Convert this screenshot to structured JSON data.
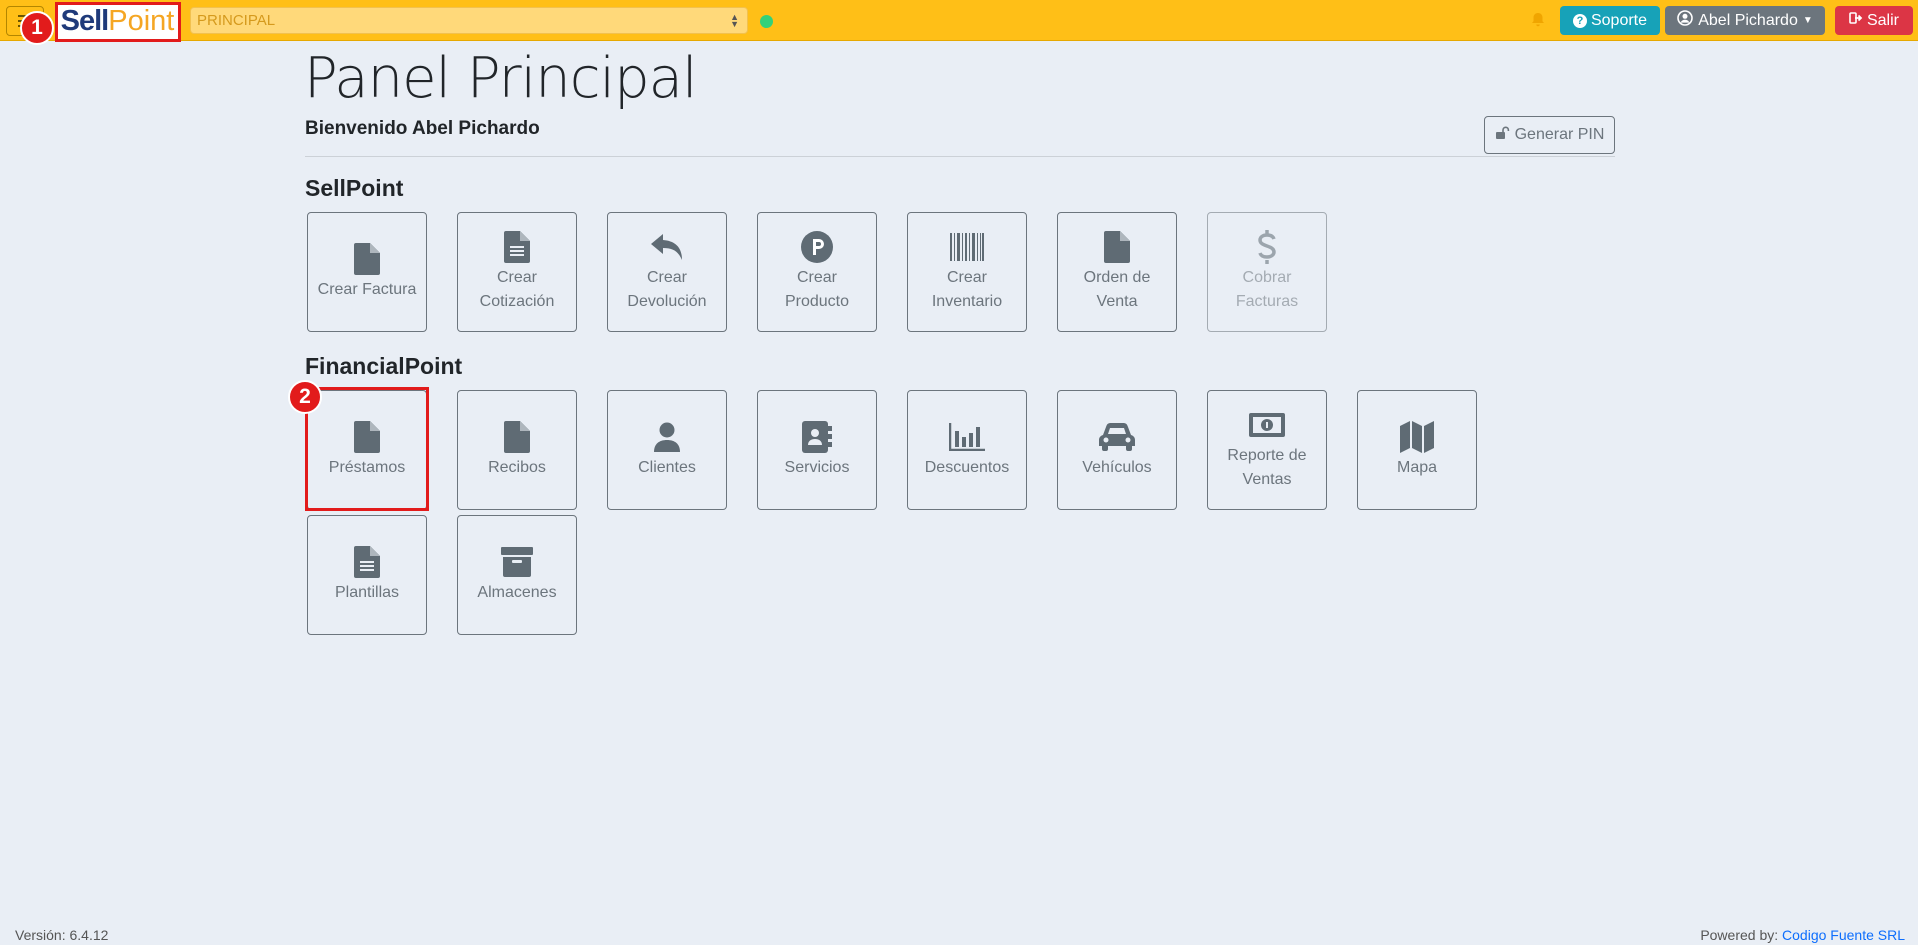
{
  "topbar": {
    "logo_sell": "Sell",
    "logo_point": "Point",
    "company_select": "PRINCIPAL",
    "soporte_label": "Soporte",
    "user_label": "Abel Pichardo",
    "salir_label": "Salir"
  },
  "callouts": [
    "1",
    "2"
  ],
  "header": {
    "title": "Panel Principal",
    "welcome": "Bienvenido Abel Pichardo",
    "pin_label": "Generar PIN"
  },
  "sections": {
    "sellpoint": {
      "title": "SellPoint",
      "tiles": [
        {
          "label": "Crear Factura",
          "icon": "file-icon"
        },
        {
          "label": "Crear Cotización",
          "icon": "file-lines-icon"
        },
        {
          "label": "Crear Devolución",
          "icon": "reply-icon"
        },
        {
          "label": "Crear Producto",
          "icon": "parking-circle-icon"
        },
        {
          "label": "Crear Inventario",
          "icon": "barcode-icon"
        },
        {
          "label": "Orden de Venta",
          "icon": "file-icon"
        },
        {
          "label": "Cobrar Facturas",
          "icon": "dollar-icon",
          "disabled": true
        }
      ]
    },
    "financialpoint": {
      "title": "FinancialPoint",
      "tiles": [
        {
          "label": "Préstamos",
          "icon": "file-icon"
        },
        {
          "label": "Recibos",
          "icon": "file-icon"
        },
        {
          "label": "Clientes",
          "icon": "user-icon"
        },
        {
          "label": "Servicios",
          "icon": "address-book-icon"
        },
        {
          "label": "Descuentos",
          "icon": "bar-chart-icon"
        },
        {
          "label": "Vehículos",
          "icon": "car-icon"
        },
        {
          "label": "Reporte de Ventas",
          "icon": "money-bill-icon"
        },
        {
          "label": "Mapa",
          "icon": "map-icon"
        },
        {
          "label": "Plantillas",
          "icon": "file-lines-icon"
        },
        {
          "label": "Almacenes",
          "icon": "archive-icon"
        }
      ]
    }
  },
  "footer": {
    "version": "Versión: 6.4.12",
    "powered_by": "Powered by:",
    "company_link": "Codigo Fuente SRL"
  },
  "colors": {
    "topbar": "#ffbf17",
    "soporte": "#17a2b8",
    "user": "#6c757d",
    "salir": "#dc3545",
    "callout": "#e21b1b",
    "icon": "#5f6b74"
  }
}
